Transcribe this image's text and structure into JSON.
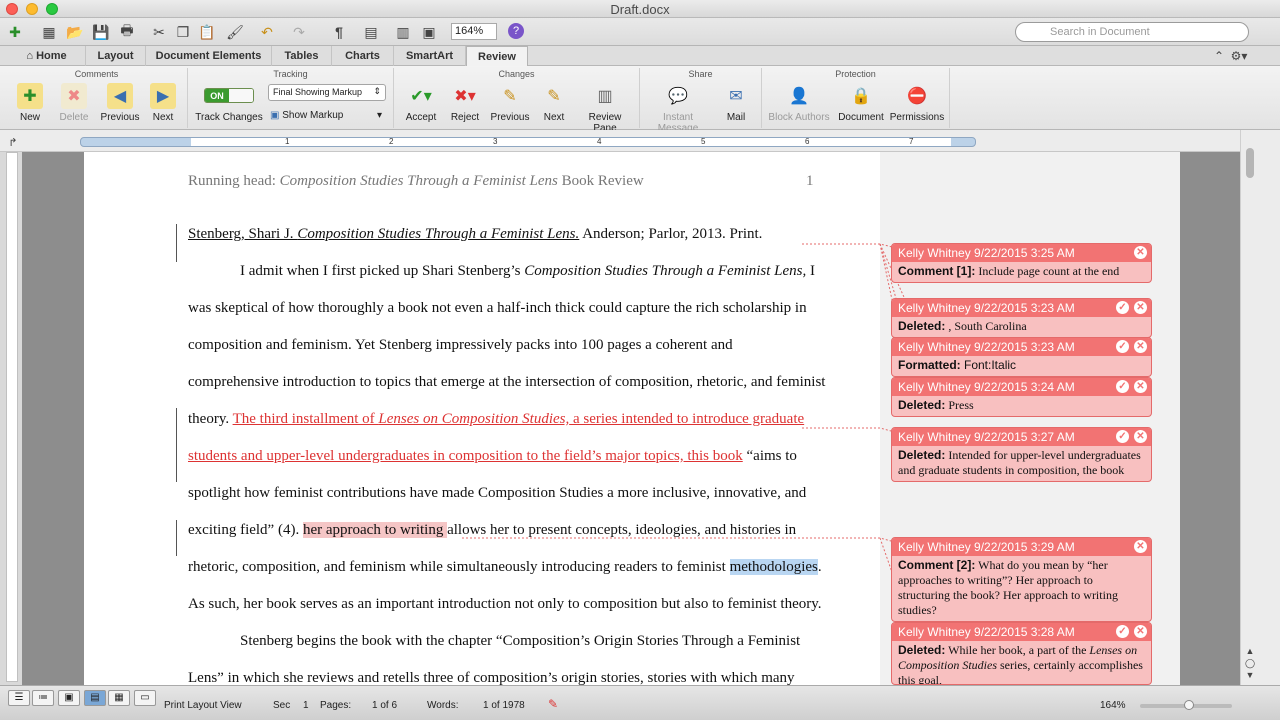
{
  "window": {
    "title": "Draft.docx"
  },
  "search": {
    "placeholder": "Search in Document"
  },
  "toolbar": {
    "zoom": "164%"
  },
  "tabs": [
    "Home",
    "Layout",
    "Document Elements",
    "Tables",
    "Charts",
    "SmartArt",
    "Review"
  ],
  "ribbon": {
    "groups": {
      "comments": "Comments",
      "tracking": "Tracking",
      "changes": "Changes",
      "share": "Share",
      "protection": "Protection"
    },
    "new": "New",
    "delete": "Delete",
    "previous": "Previous",
    "next": "Next",
    "toggle_on": "ON",
    "track_changes": "Track Changes",
    "markup_mode": "Final Showing Markup",
    "show_markup": "Show Markup",
    "accept": "Accept",
    "reject": "Reject",
    "previous2": "Previous",
    "next2": "Next",
    "review_pane": "Review Pane",
    "instant_message": "Instant Message",
    "mail": "Mail",
    "block_authors": "Block Authors",
    "document": "Document",
    "permissions": "Permissions"
  },
  "ruler": {
    "numbers": [
      "1",
      "2",
      "3",
      "4",
      "5",
      "6",
      "7"
    ]
  },
  "document": {
    "header_plain": "Running head: ",
    "header_italic": "Composition Studies Through a Feminist Lens",
    "header_tail": " Book Review",
    "page_number": "1",
    "l1_a": "Stenberg, Shari J. ",
    "l1_b": "Composition Studies Through a Feminist Lens.",
    "l1_c": " Anderson; Parlor, 2013. Print.",
    "l2_a": "I admit when I first picked up Shari Stenberg’s ",
    "l2_b": "Composition Studies Through a Feminist Lens,",
    "l2_c": " I",
    "l3": "was skeptical of how thoroughly a book not even a half-inch thick could capture the rich scholarship in",
    "l4": "composition and feminism. Yet Stenberg impressively packs into 100 pages a coherent and",
    "l5": "comprehensive introduction to topics that emerge at the intersection of composition, rhetoric, and feminist",
    "l6_a": "theory. ",
    "l6_b": "The third installment of ",
    "l6_c": "Lenses on Composition Studies,",
    "l6_d": " a series intended to introduce graduate",
    "l7_a": "students and upper-level undergraduates in composition to the field’s major topics, this book",
    "l7_b": " “aims to",
    "l8": "spotlight how feminist contributions have made Composition Studies a more inclusive, innovative, and",
    "l9_a": "exciting field” (4). ",
    "l9_b": "her approach to writing ",
    "l9_c": "allows her to present concepts, ideologies, and histories in",
    "l10_a": "rhetoric, composition, and feminism while simultaneously introducing readers to feminist ",
    "l10_b": "methodologies",
    "l10_c": ".",
    "l11": "As such, her book serves as an important introduction not only to composition but also to feminist theory.",
    "l12": "Stenberg begins the book with the chapter “Composition’s Origin Stories Through a Feminist",
    "l13": "Lens” in which she reviews and retells three of composition’s origin stories, stories with which many"
  },
  "balloons": [
    {
      "head": "Kelly Whitney 9/22/2015 3:25 AM",
      "label": "Comment [1]:",
      "text": " Include page count at the end"
    },
    {
      "head": "Kelly Whitney 9/22/2015 3:23 AM",
      "label": "Deleted:",
      "text": " , South Carolina"
    },
    {
      "head": "Kelly Whitney 9/22/2015 3:23 AM",
      "label": "Formatted:",
      "text": " Font:Italic"
    },
    {
      "head": "Kelly Whitney 9/22/2015 3:24 AM",
      "label": "Deleted:",
      "text": "  Press"
    },
    {
      "head": "Kelly Whitney 9/22/2015 3:27 AM",
      "label": "Deleted:",
      "text": " Intended for upper-level undergraduates and graduate students in composition, the book"
    },
    {
      "head": "Kelly Whitney 9/22/2015 3:29 AM",
      "label": "Comment [2]:",
      "text": " What do you mean by “her approaches to writing”? Her approach to structuring the book? Her approach to writing studies?"
    },
    {
      "head": "Kelly Whitney 9/22/2015 3:28 AM",
      "label": "Deleted:",
      "text": " While her book, a part of the",
      "text_italic": "Lenses on Composition Studies",
      "text_tail": " series, certainly accomplishes this goal,"
    }
  ],
  "status": {
    "view": "Print Layout View",
    "sec_label": "Sec",
    "sec": "1",
    "pages_label": "Pages:",
    "pages": "1 of 6",
    "words_label": "Words:",
    "words": "1 of 1978",
    "zoom": "164%"
  }
}
